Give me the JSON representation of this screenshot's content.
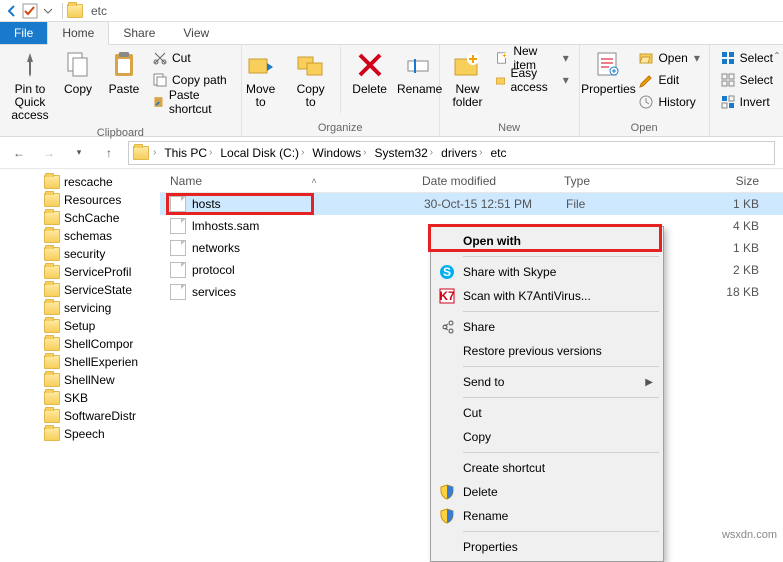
{
  "window": {
    "title": "etc"
  },
  "tabs": {
    "file": "File",
    "home": "Home",
    "share": "Share",
    "view": "View"
  },
  "ribbon": {
    "clipboard": {
      "label": "Clipboard",
      "pin": "Pin to Quick access",
      "copy": "Copy",
      "paste": "Paste",
      "cut": "Cut",
      "copypath": "Copy path",
      "pasteshortcut": "Paste shortcut"
    },
    "organize": {
      "label": "Organize",
      "moveto": "Move to",
      "copyto": "Copy to",
      "delete": "Delete",
      "rename": "Rename"
    },
    "new": {
      "label": "New",
      "newfolder": "New folder",
      "newitem": "New item",
      "easyaccess": "Easy access"
    },
    "open": {
      "label": "Open",
      "properties": "Properties",
      "open": "Open",
      "edit": "Edit",
      "history": "History"
    },
    "select": {
      "selectall": "Select",
      "selectnone": "Select",
      "invert": "Invert"
    }
  },
  "breadcrumbs": [
    "This PC",
    "Local Disk (C:)",
    "Windows",
    "System32",
    "drivers",
    "etc"
  ],
  "tree": [
    "rescache",
    "Resources",
    "SchCache",
    "schemas",
    "security",
    "ServiceProfil",
    "ServiceState",
    "servicing",
    "Setup",
    "ShellCompor",
    "ShellExperien",
    "ShellNew",
    "SKB",
    "SoftwareDistr",
    "Speech"
  ],
  "columns": {
    "name": "Name",
    "date": "Date modified",
    "type": "Type",
    "size": "Size"
  },
  "files": [
    {
      "name": "hosts",
      "date": "30-Oct-15 12:51 PM",
      "type": "File",
      "size": "1 KB",
      "selected": true
    },
    {
      "name": "lmhosts.sam",
      "date": "",
      "type": "",
      "size": "4 KB"
    },
    {
      "name": "networks",
      "date": "",
      "type": "",
      "size": "1 KB"
    },
    {
      "name": "protocol",
      "date": "",
      "type": "",
      "size": "2 KB"
    },
    {
      "name": "services",
      "date": "",
      "type": "",
      "size": "18 KB"
    }
  ],
  "context": {
    "openwith": "Open with",
    "skype": "Share with Skype",
    "k7": "Scan with K7AntiVirus...",
    "share": "Share",
    "restore": "Restore previous versions",
    "sendto": "Send to",
    "cut": "Cut",
    "copy": "Copy",
    "createshortcut": "Create shortcut",
    "delete": "Delete",
    "rename": "Rename",
    "properties": "Properties"
  },
  "watermark": "wsxdn.com"
}
